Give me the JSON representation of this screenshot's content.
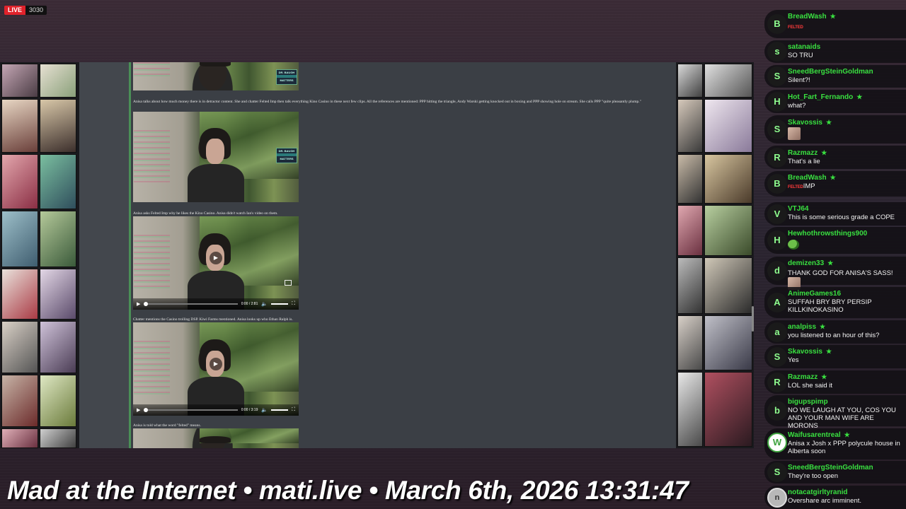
{
  "stream": {
    "live_label": "LIVE",
    "viewer_count": "3030",
    "ticker": "Mad at the Internet • mati.live • March 6th, 2026 13:31:47"
  },
  "page": {
    "captions": [
      "Anisa talks about how much money there is in detractor content. She and chatter Felted Imp then talk everything Kino Casino in these next few clips. All the references are mentioned: PPP hitting the triangle, Andy Warski getting knocked out in boxing and PPP showing hole on stream. She calls PPP \"quite pleasantly plump.\"",
      "Anisa asks Felted Imp why he likes the Kino Casino. Anisa didn't watch Ian's video on them.",
      "Chatter mentions the Casino trolling DSP. Kiwi Farms mentioned. Anisa looks up who Ethan Ralph is.",
      "Anisa is told what the word \"felted\" means."
    ],
    "logo_text": [
      "DR. BAUGH",
      "MATTERS"
    ],
    "videos": [
      {
        "time": "0:00 / 2:81"
      },
      {
        "time": "0:00 / 3:19"
      }
    ]
  },
  "chat": [
    {
      "initial": "B",
      "user": "BreadWash",
      "star": true,
      "text": "",
      "emote": "FELTED"
    },
    {
      "initial": "s",
      "user": "satanaids",
      "star": false,
      "text": "SO TRU"
    },
    {
      "initial": "S",
      "user": "SneedBergSteinGoldman",
      "star": false,
      "text": "Silent?!"
    },
    {
      "initial": "H",
      "user": "Hot_Fart_Fernando",
      "star": true,
      "text": "what?"
    },
    {
      "initial": "S",
      "user": "Skavossis",
      "star": true,
      "text": "",
      "emote": "face"
    },
    {
      "initial": "R",
      "user": "Razmazz",
      "star": true,
      "text": "That's a lie"
    },
    {
      "initial": "B",
      "user": "BreadWash",
      "star": true,
      "text": "IMP",
      "emote": "FELTED"
    },
    {
      "initial": "V",
      "user": "VTJ64",
      "star": false,
      "text": "This is some serious grade a COPE"
    },
    {
      "initial": "H",
      "user": "Hewhothrowsthings900",
      "star": false,
      "text": "",
      "emote": "frog"
    },
    {
      "initial": "d",
      "user": "demizen33",
      "star": true,
      "text": "THANK GOD FOR ANISA'S SASS!",
      "emote": "face"
    },
    {
      "initial": "A",
      "user": "AnimeGames16",
      "star": false,
      "text": "SUFFAH BRY BRY PERSIP KILLKINOKASINO"
    },
    {
      "initial": "a",
      "user": "analpiss",
      "star": true,
      "text": "you listened to an hour of this?"
    },
    {
      "initial": "S",
      "user": "Skavossis",
      "star": true,
      "text": "Yes"
    },
    {
      "initial": "R",
      "user": "Razmazz",
      "star": true,
      "text": "LOL she said it"
    },
    {
      "initial": "b",
      "user": "bigupspimp",
      "star": false,
      "text": "NO WE LAUGH AT YOU, COS YOU AND YOUR MAN WIFE ARE MORONS"
    },
    {
      "initial": "W",
      "user": "Waifusarentreal",
      "star": true,
      "text": "Anisa x Josh x PPP polycule house in Alberta soon"
    },
    {
      "initial": "S",
      "user": "SneedBergSteinGoldman",
      "star": false,
      "text": "They're too open"
    },
    {
      "initial": "n",
      "user": "notacatgirltyranid",
      "star": false,
      "text": "Overshare arc imminent."
    }
  ]
}
